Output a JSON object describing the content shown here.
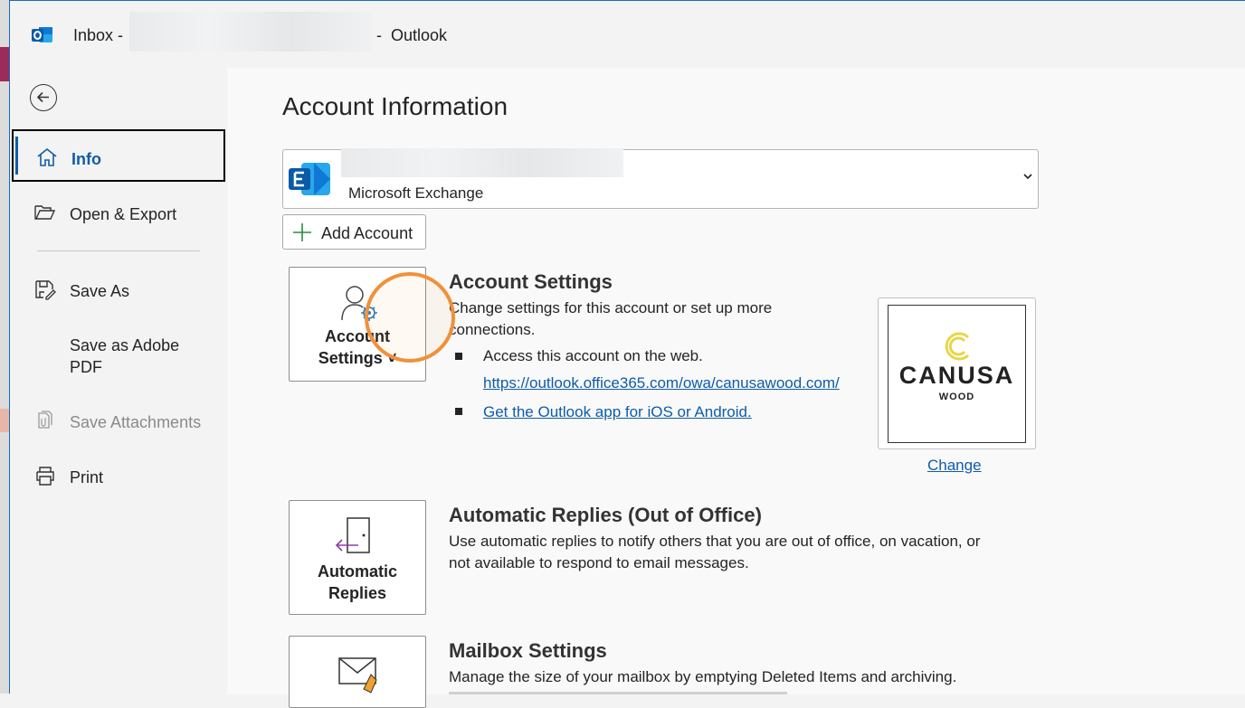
{
  "titlebar": {
    "app_prefix": "Inbox -",
    "separator": "-",
    "app_name": "Outlook",
    "app_icon": "outlook-icon"
  },
  "sidebar": {
    "back_icon": "back-arrow-icon",
    "items": [
      {
        "label": "Info",
        "icon": "home-icon",
        "active": true
      },
      {
        "label": "Open & Export",
        "icon": "folder-open-icon"
      },
      {
        "label": "Save As",
        "icon": "save-as-icon"
      },
      {
        "label": "Save as Adobe PDF",
        "icon": ""
      },
      {
        "label": "Save Attachments",
        "icon": "attachments-icon",
        "disabled": true
      },
      {
        "label": "Print",
        "icon": "printer-icon"
      }
    ]
  },
  "main": {
    "page_title": "Account Information",
    "account": {
      "type": "Microsoft Exchange",
      "icon": "exchange-icon"
    },
    "add_account_label": "Add Account",
    "account_settings": {
      "tile_label_line1": "Account",
      "tile_label_line2": "Settings ˅",
      "title": "Account Settings",
      "description_line1": "Change settings for this account or set up more",
      "description_line2": "connections.",
      "bullet1": "Access this account on the web.",
      "web_link": "https://outlook.office365.com/owa/canusawood.com/",
      "app_link": "Get the Outlook app for iOS or Android."
    },
    "profile_logo": {
      "name": "CANUSA",
      "sub": "WOOD",
      "change_label": "Change"
    },
    "automatic_replies": {
      "tile_label_line1": "Automatic",
      "tile_label_line2": "Replies",
      "title": "Automatic Replies (Out of Office)",
      "description_line1": "Use automatic replies to notify others that you are out of office, on vacation, or",
      "description_line2": "not available to respond to email messages."
    },
    "mailbox_settings": {
      "title": "Mailbox Settings",
      "description": "Manage the size of your mailbox by emptying Deleted Items and archiving."
    }
  },
  "colors": {
    "accent": "#0f5ca8",
    "cursor_ring": "#f0913a",
    "exchange_blue": "#0f6cbd"
  }
}
